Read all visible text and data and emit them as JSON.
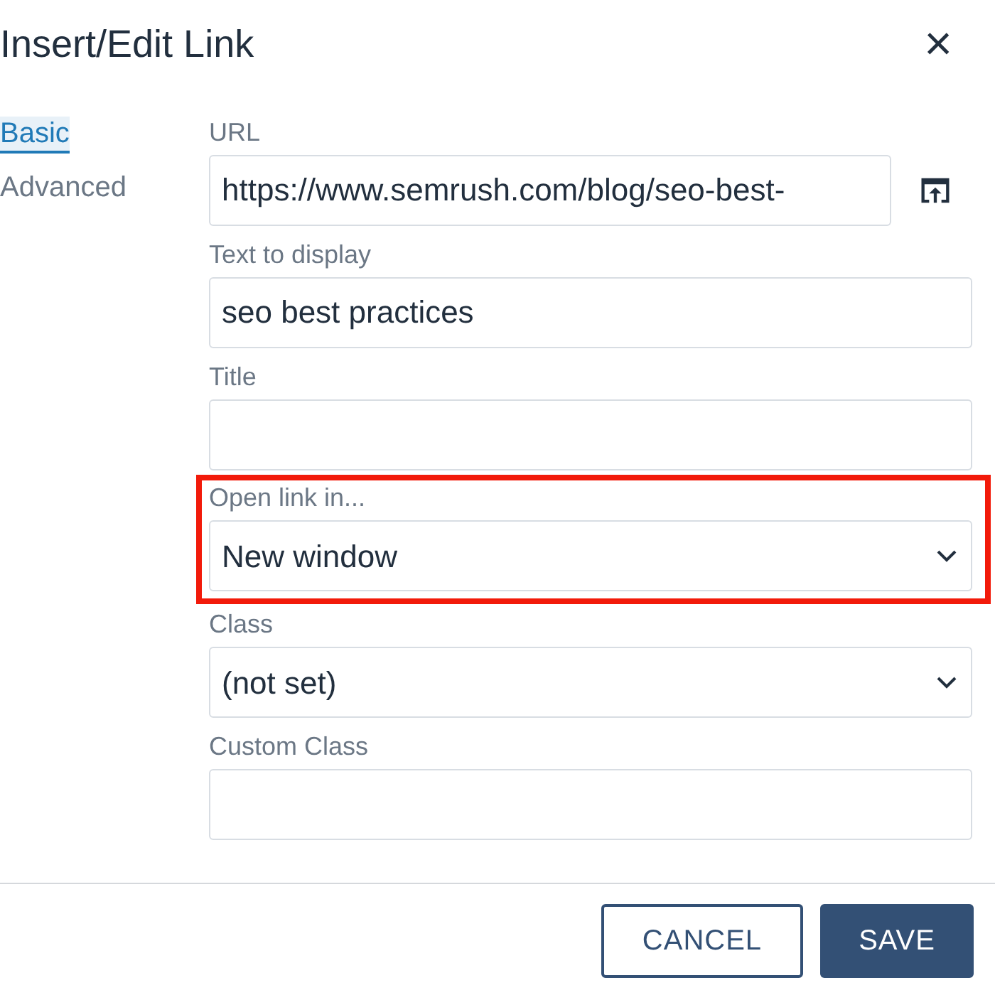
{
  "dialog": {
    "title": "Insert/Edit Link",
    "close": "×"
  },
  "tabs": [
    {
      "label": "Basic",
      "selected": true
    },
    {
      "label": "Advanced",
      "selected": false
    }
  ],
  "fields": [
    {
      "kind": "text",
      "label": "URL",
      "value": "https://www.semrush.com/blog/seo-best-",
      "browse": true
    },
    {
      "kind": "text",
      "label": "Text to display",
      "value": "seo best practices"
    },
    {
      "kind": "text",
      "label": "Title"
    },
    {
      "kind": "select",
      "label": "Open link in...",
      "value": "New window",
      "highlighted": true
    },
    {
      "kind": "select",
      "label": "Class",
      "value": "(not set)"
    },
    {
      "kind": "text",
      "label": "Custom Class"
    }
  ],
  "buttons": [
    {
      "label": "CANCEL",
      "kind": "secondary"
    },
    {
      "label": "SAVE",
      "kind": "primary"
    }
  ]
}
